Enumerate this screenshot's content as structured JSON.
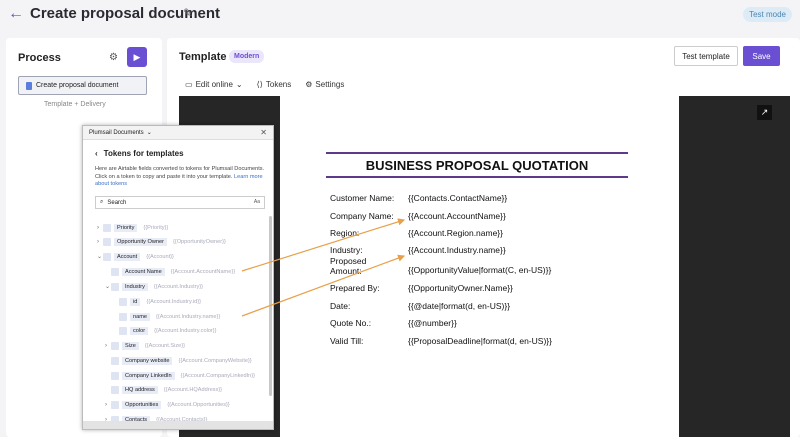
{
  "header": {
    "title": "Create proposal document",
    "test_mode": "Test mode"
  },
  "process": {
    "title": "Process",
    "step_label": "Create proposal document",
    "flow_template": "Template",
    "flow_delivery": "Delivery"
  },
  "template": {
    "title": "Template",
    "badge": "Modern",
    "test_button": "Test template",
    "save_button": "Save",
    "toolbar": {
      "edit_online": "Edit online",
      "tokens": "Tokens",
      "settings": "Settings"
    }
  },
  "document": {
    "heading": "BUSINESS PROPOSAL QUOTATION",
    "rows": [
      {
        "label": "Customer Name:",
        "token": "{{Contacts.ContactName}}"
      },
      {
        "label": "Company Name:",
        "token": "{{Account.AccountName}}"
      },
      {
        "label": "Region:",
        "token": "{{Account.Region.name}}"
      },
      {
        "label": "Industry:",
        "token": "{{Account.Industry.name}}"
      },
      {
        "label": "Proposed Amount:",
        "token": "{{OpportunityValue|format(C, en-US)}}"
      },
      {
        "label": "Prepared By:",
        "token": "{{OpportunityOwner.Name}}"
      },
      {
        "label": "Date:",
        "token": "{{@date|format(d, en-US)}}"
      },
      {
        "label": "Quote No.:",
        "token": "{{@number}}"
      },
      {
        "label": "Valid Till:",
        "token": "{{ProposalDeadline|format(d, en-US)}}"
      }
    ]
  },
  "popup": {
    "app_name": "Plumsail Documents",
    "title": "Tokens for templates",
    "desc": "Here are Airtable fields converted to tokens for Plumsail Documents. Click on a token to copy and paste it into your template.",
    "learn_more": "Learn more about tokens",
    "search_placeholder": "Search",
    "search_aux": "Aa",
    "tokens": [
      {
        "label": "Priority",
        "key": "{{Priority}}"
      },
      {
        "label": "Opportunity Owner",
        "key": "{{OpportunityOwner}}"
      },
      {
        "label": "Account",
        "key": "{{Account}}"
      },
      {
        "label": "Account Name",
        "key": "{{Account.AccountName}}"
      },
      {
        "label": "Industry",
        "key": "{{Account.Industry}}"
      },
      {
        "label": "id",
        "key": "{{Account.Industry.id}}"
      },
      {
        "label": "name",
        "key": "{{Account.Industry.name}}"
      },
      {
        "label": "color",
        "key": "{{Account.Industry.color}}"
      },
      {
        "label": "Size",
        "key": "{{Account.Size}}"
      },
      {
        "label": "Company website",
        "key": "{{Account.CompanyWebsite}}"
      },
      {
        "label": "Company LinkedIn",
        "key": "{{Account.CompanyLinkedIn}}"
      },
      {
        "label": "HQ address",
        "key": "{{Account.HQAddress}}"
      },
      {
        "label": "Opportunities",
        "key": "{{Account.Opportunities}}"
      },
      {
        "label": "Contacts",
        "key": "{{Account.Contacts}}"
      }
    ]
  },
  "colors": {
    "accent": "#6b4fd2",
    "arrow": "#e8a04a"
  }
}
